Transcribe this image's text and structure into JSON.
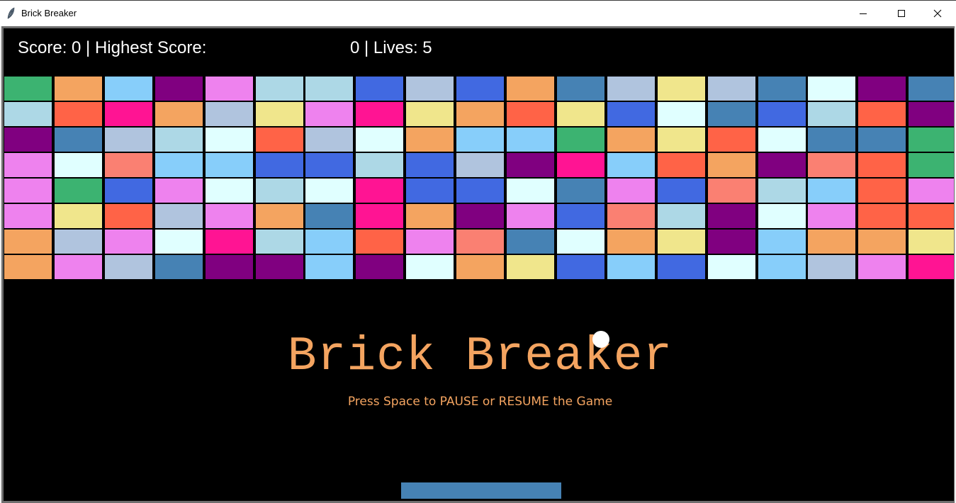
{
  "window": {
    "title": "Brick Breaker",
    "controls": [
      "minimize",
      "maximize",
      "close"
    ]
  },
  "hud": {
    "left_text": "Score: 0 | Highest Score:",
    "right_text": "0 | Lives: 5",
    "score": 0,
    "highest_score": 0,
    "lives": 5
  },
  "game": {
    "title": "Brick Breaker",
    "instruction": "Press Space to PAUSE or RESUME the Game",
    "colors": {
      "background": "#000000",
      "text_accent": "#f4a460",
      "paddle": "#4682b4",
      "ball": "#ffffff"
    },
    "brick_rows": [
      [
        "#3cb371",
        "#f4a460",
        "#87cefa",
        "#800080",
        "#ee82ee",
        "#add8e6",
        "#add8e6",
        "#4169e1",
        "#b0c4de",
        "#4169e1",
        "#f4a460",
        "#4682b4",
        "#b0c4de",
        "#f0e68c",
        "#b0c4de",
        "#4682b4",
        "#e0ffff",
        "#800080",
        "#4682b4"
      ],
      [
        "#add8e6",
        "#ff6347",
        "#ff1493",
        "#f4a460",
        "#b0c4de",
        "#f0e68c",
        "#ee82ee",
        "#ff1493",
        "#f0e68c",
        "#f4a460",
        "#ff6347",
        "#f0e68c",
        "#4169e1",
        "#e0ffff",
        "#4682b4",
        "#4169e1",
        "#add8e6",
        "#ff6347",
        "#800080"
      ],
      [
        "#800080",
        "#4682b4",
        "#b0c4de",
        "#add8e6",
        "#e0ffff",
        "#ff6347",
        "#b0c4de",
        "#e0ffff",
        "#f4a460",
        "#87cefa",
        "#87cefa",
        "#3cb371",
        "#f4a460",
        "#f0e68c",
        "#ff6347",
        "#e0ffff",
        "#4682b4",
        "#4682b4",
        "#3cb371"
      ],
      [
        "#ee82ee",
        "#e0ffff",
        "#fa8072",
        "#87cefa",
        "#87cefa",
        "#4169e1",
        "#4169e1",
        "#add8e6",
        "#4169e1",
        "#b0c4de",
        "#800080",
        "#ff1493",
        "#87cefa",
        "#ff6347",
        "#f4a460",
        "#800080",
        "#fa8072",
        "#ff6347",
        "#3cb371"
      ],
      [
        "#ee82ee",
        "#3cb371",
        "#4169e1",
        "#ee82ee",
        "#e0ffff",
        "#add8e6",
        "#e0ffff",
        "#ff1493",
        "#4169e1",
        "#4169e1",
        "#e0ffff",
        "#4682b4",
        "#ee82ee",
        "#4169e1",
        "#fa8072",
        "#add8e6",
        "#87cefa",
        "#ff6347",
        "#ee82ee"
      ],
      [
        "#ee82ee",
        "#f0e68c",
        "#ff6347",
        "#b0c4de",
        "#ee82ee",
        "#f4a460",
        "#4682b4",
        "#ff1493",
        "#f4a460",
        "#800080",
        "#ee82ee",
        "#4169e1",
        "#fa8072",
        "#add8e6",
        "#800080",
        "#e0ffff",
        "#ee82ee",
        "#ff6347",
        "#ff6347"
      ],
      [
        "#f4a460",
        "#b0c4de",
        "#ee82ee",
        "#e0ffff",
        "#ff1493",
        "#add8e6",
        "#87cefa",
        "#ff6347",
        "#ee82ee",
        "#fa8072",
        "#4682b4",
        "#e0ffff",
        "#f4a460",
        "#f0e68c",
        "#800080",
        "#87cefa",
        "#f4a460",
        "#f4a460",
        "#f0e68c"
      ],
      [
        "#f4a460",
        "#ee82ee",
        "#b0c4de",
        "#4682b4",
        "#800080",
        "#800080",
        "#87cefa",
        "#800080",
        "#e0ffff",
        "#f4a460",
        "#f0e68c",
        "#4169e1",
        "#87cefa",
        "#4169e1",
        "#e0ffff",
        "#87cefa",
        "#b0c4de",
        "#ee82ee",
        "#ff1493"
      ]
    ]
  }
}
